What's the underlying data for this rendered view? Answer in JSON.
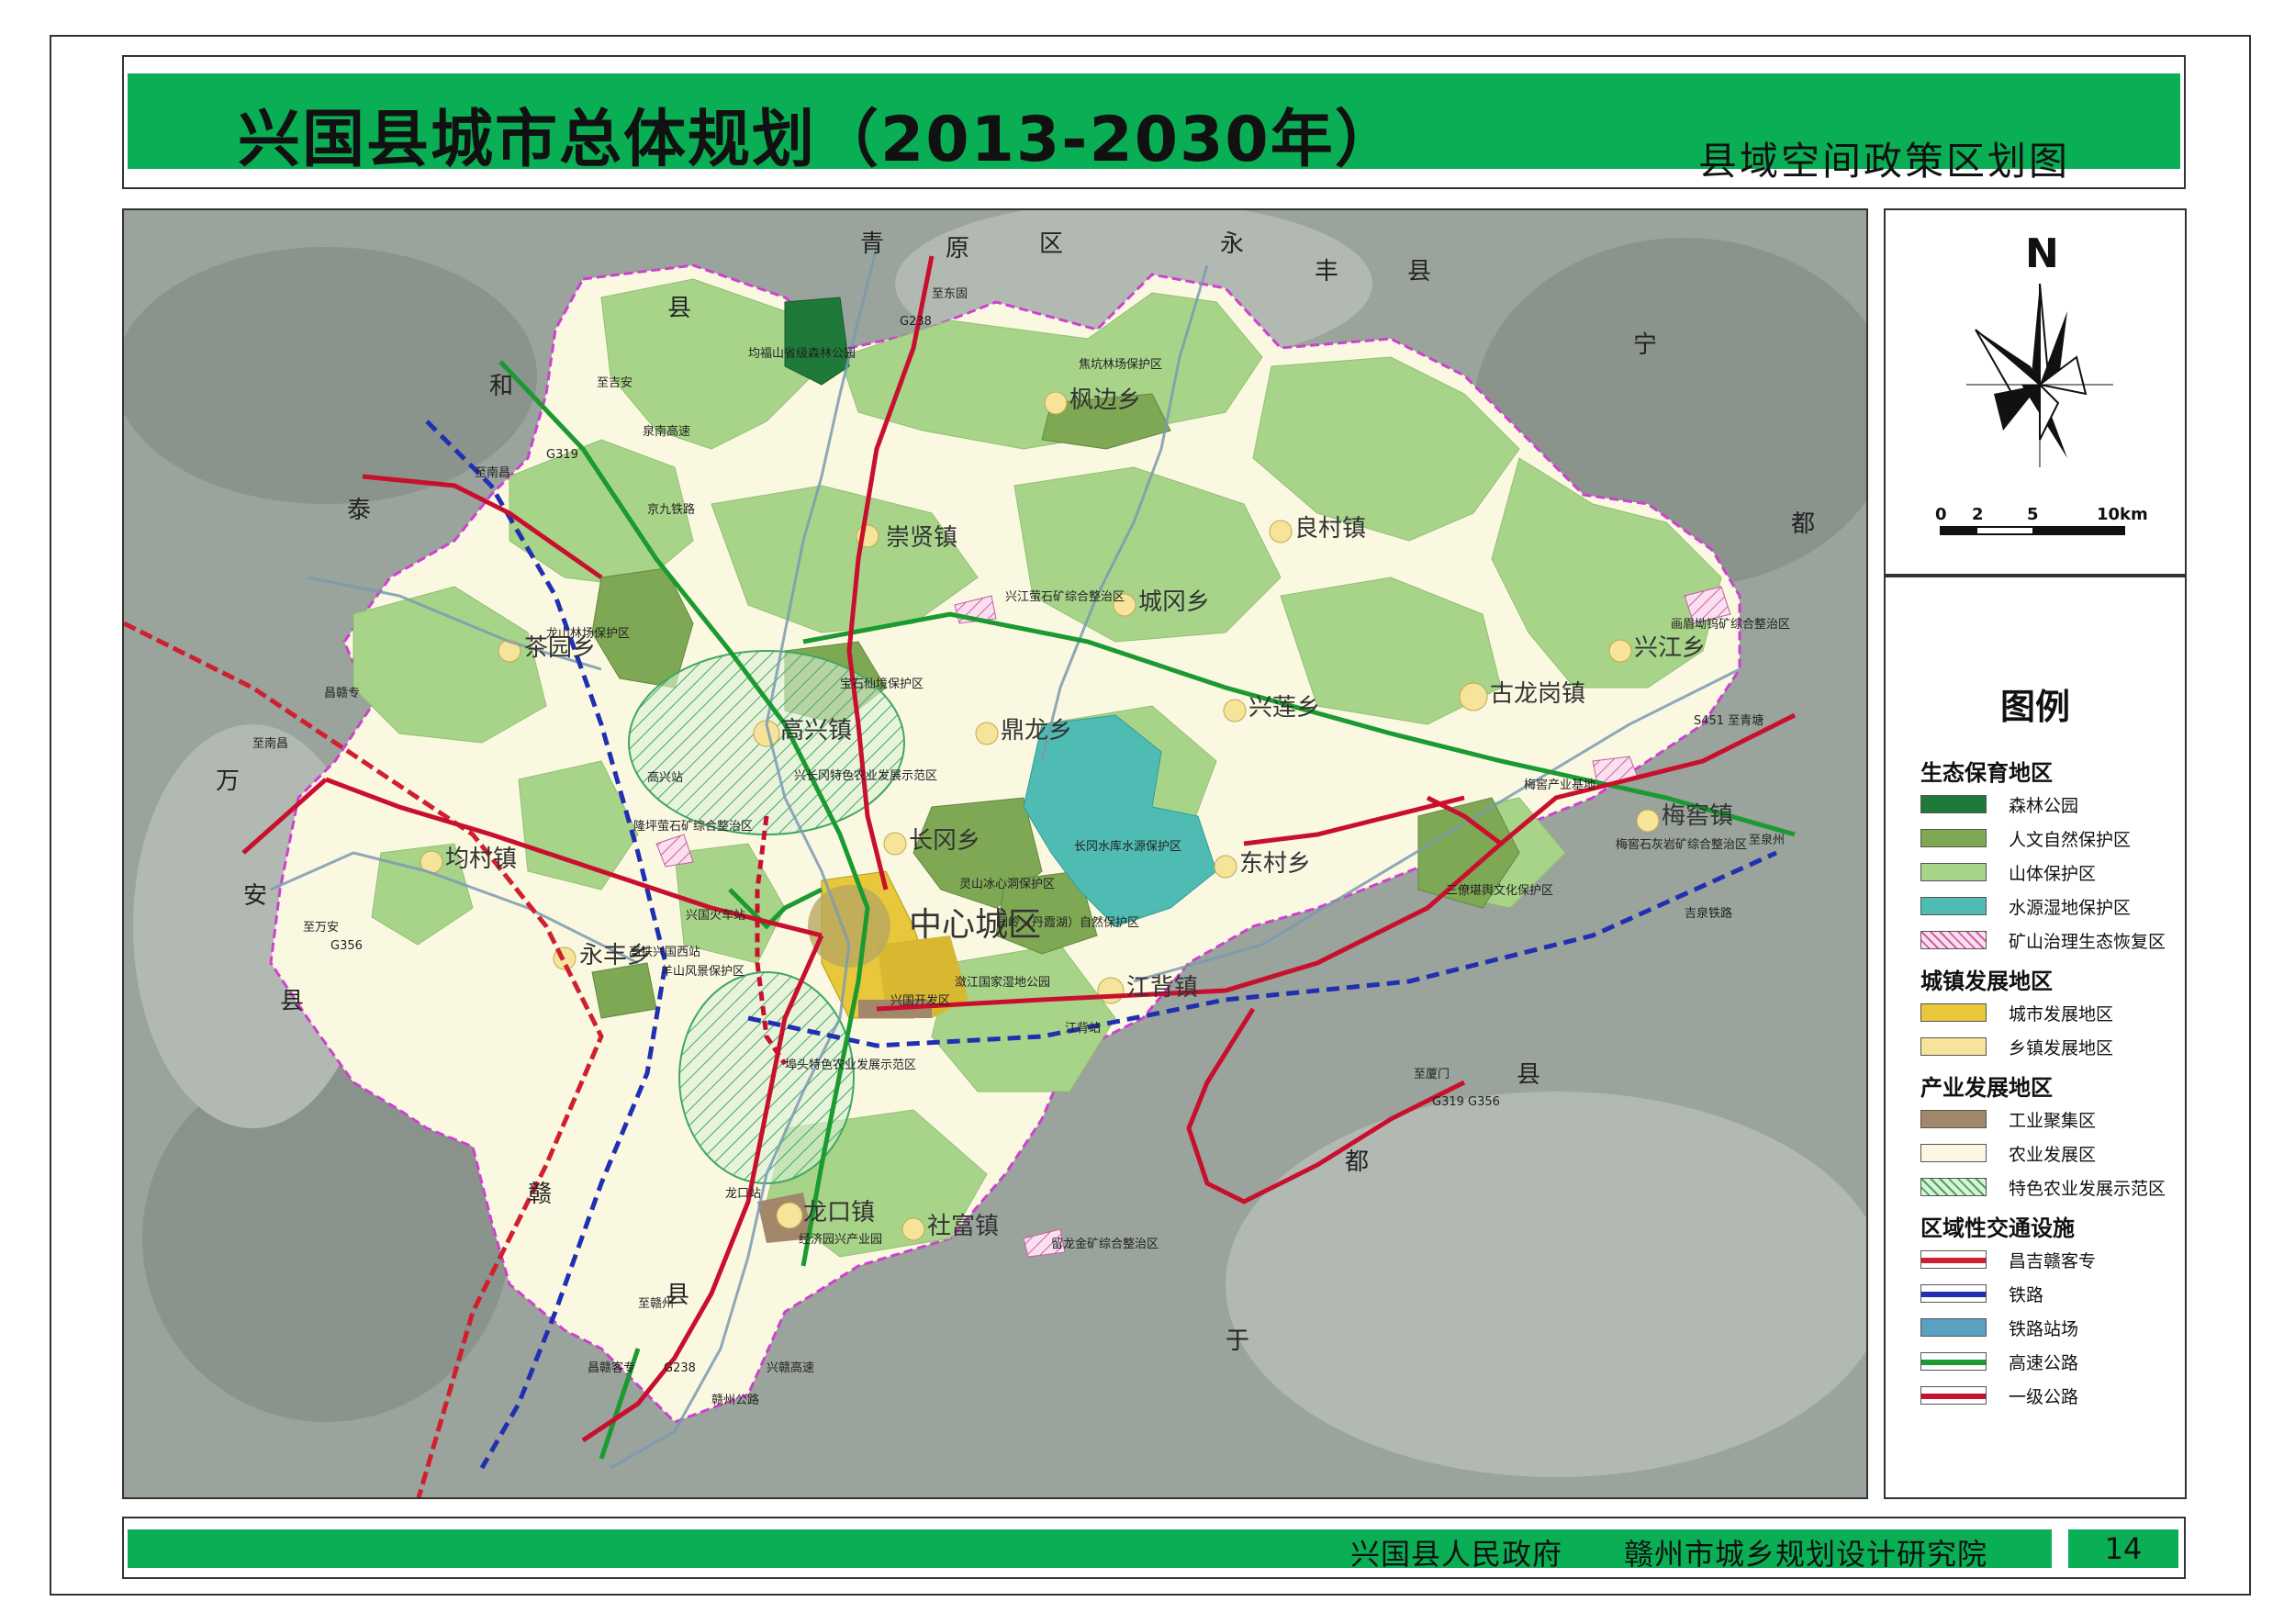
{
  "header": {
    "title": "兴国县城市总体规划（2013-2030年）",
    "subtitle": "县域空间政策区划图"
  },
  "north_arrow": {
    "letter": "N"
  },
  "scale_bar": {
    "ticks": [
      "0",
      "2",
      "5",
      "10km"
    ]
  },
  "legend": {
    "title": "图例",
    "groups": [
      {
        "heading": "生态保育地区",
        "items": [
          {
            "label": "森林公园",
            "color": "#1f7a3a"
          },
          {
            "label": "人文自然保护区",
            "color": "#7fa855"
          },
          {
            "label": "山体保护区",
            "color": "#a8d48a"
          },
          {
            "label": "水源湿地保护区",
            "color": "#4fbcb4"
          },
          {
            "label": "矿山治理生态恢复区",
            "color": "#f3c6e4"
          }
        ]
      },
      {
        "heading": "城镇发展地区",
        "items": [
          {
            "label": "城市发展地区",
            "color": "#e8c83a"
          },
          {
            "label": "乡镇发展地区",
            "color": "#f6e49a"
          }
        ]
      },
      {
        "heading": "产业发展地区",
        "items": [
          {
            "label": "工业聚集区",
            "color": "#a3876a"
          },
          {
            "label": "农业发展区",
            "color": "#fbf8e2"
          },
          {
            "label": "特色农业发展示范区",
            "color": "#d9f0dc"
          }
        ]
      },
      {
        "heading": "区域性交通设施",
        "items": [
          {
            "label": "昌吉赣客专",
            "color": "#d02030"
          },
          {
            "label": "铁路",
            "color": "#2030b0"
          },
          {
            "label": "铁路站场",
            "color": "#5aa0c0"
          },
          {
            "label": "高速公路",
            "color": "#1a9a30"
          },
          {
            "label": "一级公路",
            "color": "#c8102e"
          }
        ]
      }
    ]
  },
  "map": {
    "neighbors": [
      {
        "chars": [
          "青",
          "原",
          "区"
        ],
        "kind": "neighbor"
      },
      {
        "chars": [
          "永",
          "丰",
          "县"
        ],
        "kind": "neighbor"
      },
      {
        "chars": [
          "宁",
          "都"
        ],
        "kind": "neighbor"
      },
      {
        "chars": [
          "泰",
          "和",
          "县"
        ],
        "kind": "neighbor"
      },
      {
        "chars": [
          "万",
          "安",
          "县"
        ],
        "kind": "neighbor"
      },
      {
        "chars": [
          "赣",
          "县"
        ],
        "kind": "neighbor"
      },
      {
        "chars": [
          "于",
          "都",
          "县"
        ],
        "kind": "neighbor"
      }
    ],
    "center": "中心城区",
    "towns": [
      "崇贤镇",
      "枫边乡",
      "良村镇",
      "城冈乡",
      "兴江乡",
      "茶园乡",
      "高兴镇",
      "鼎龙乡",
      "兴莲乡",
      "古龙岗镇",
      "均村镇",
      "长冈乡",
      "东村乡",
      "永丰乡",
      "江背镇",
      "梅窖镇",
      "龙口镇",
      "社富镇"
    ],
    "zones": [
      "均福山省级森林公园",
      "焦坑林场保护区",
      "龙山林场保护区",
      "宝石仙境保护区",
      "兴江萤石矿综合整治区",
      "画眉坳钨矿综合整治区",
      "兴长冈特色农业发展示范区",
      "隆坪萤石矿综合整治区",
      "长冈水库水源保护区",
      "灵山冰心洞保护区",
      "园岭（丹霞湖）自然保护区",
      "三僚堪舆文化保护区",
      "梅窖石灰岩矿综合整治区",
      "梅窖产业基地",
      "兴国开发区",
      "潋江国家湿地公园",
      "埠头特色农业发展示范区",
      "经济园兴产业园",
      "留龙金矿综合整治区",
      "羊山风景保护区"
    ],
    "stations": [
      "高兴站",
      "兴国火车站",
      "高铁兴国西站",
      "江背站",
      "龙口站"
    ],
    "route_labels": [
      "至东固",
      "G238",
      "至吉安",
      "泉南高速",
      "G319",
      "至南昌",
      "京九铁路",
      "昌赣专",
      "至南昌",
      "至万安",
      "G356",
      "S451 至青塘",
      "至泉州",
      "吉泉铁路",
      "至厦门",
      "G319 G356",
      "至赣州",
      "昌赣客专",
      "G238",
      "赣州公路",
      "兴赣高速"
    ]
  },
  "footer": {
    "text": "兴国县人民政府      赣州市城乡规划设计研究院",
    "page": "14"
  }
}
